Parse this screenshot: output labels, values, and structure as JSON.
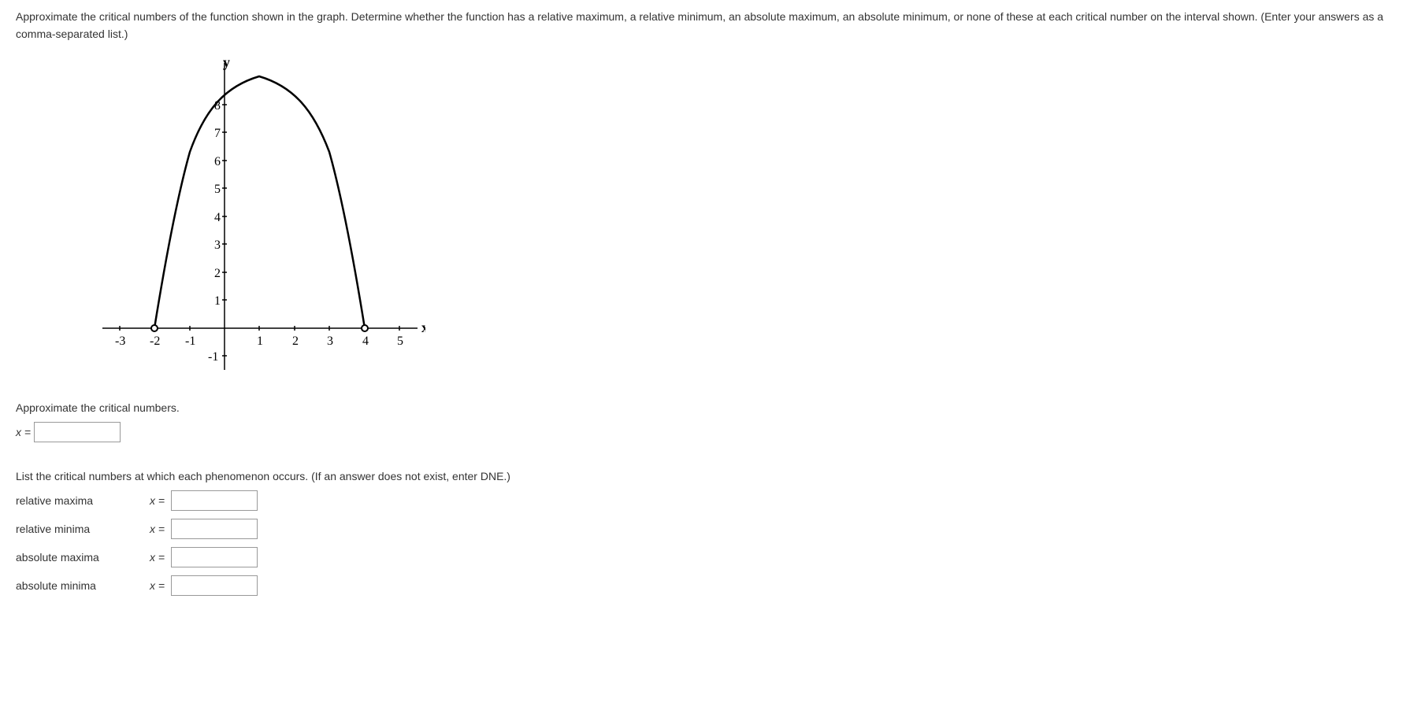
{
  "question": {
    "text": "Approximate the critical numbers of the function shown in the graph. Determine whether the function has a relative maximum, a relative minimum, an absolute maximum, an absolute minimum, or none of these at each critical number on the interval shown. (Enter your answers as a comma-separated list.)"
  },
  "chart_data": {
    "type": "line",
    "title": "",
    "xlabel": "x",
    "ylabel": "y",
    "xlim": [
      -3.5,
      5.5
    ],
    "ylim": [
      -1.5,
      9.5
    ],
    "x_ticks": [
      -3,
      -2,
      -1,
      1,
      2,
      3,
      4,
      5
    ],
    "y_ticks": [
      -1,
      1,
      2,
      3,
      4,
      5,
      6,
      7,
      8
    ],
    "x_tick_labels": [
      "-3",
      "-2",
      "-1",
      "1",
      "2",
      "3",
      "4",
      "5"
    ],
    "y_tick_labels": [
      "-1",
      "1",
      "2",
      "3",
      "4",
      "5",
      "6",
      "7",
      "8"
    ],
    "curve_description": "Downward-opening parabola-like curve",
    "endpoints": [
      {
        "x": -2,
        "y": 0,
        "open": true
      },
      {
        "x": 4,
        "y": 0,
        "open": true
      }
    ],
    "vertex": {
      "x": 1,
      "y": 9
    },
    "curve_points": [
      {
        "x": -2,
        "y": 0
      },
      {
        "x": -1.5,
        "y": 3.9
      },
      {
        "x": -1,
        "y": 6.3
      },
      {
        "x": -0.5,
        "y": 7.8
      },
      {
        "x": 0,
        "y": 8.6
      },
      {
        "x": 0.5,
        "y": 8.95
      },
      {
        "x": 1,
        "y": 9
      },
      {
        "x": 1.5,
        "y": 8.95
      },
      {
        "x": 2,
        "y": 8.6
      },
      {
        "x": 2.5,
        "y": 7.8
      },
      {
        "x": 3,
        "y": 6.3
      },
      {
        "x": 3.5,
        "y": 3.9
      },
      {
        "x": 4,
        "y": 0
      }
    ]
  },
  "prompts": {
    "approximate": "Approximate the critical numbers.",
    "list_phenomena": "List the critical numbers at which each phenomenon occurs. (If an answer does not exist, enter DNE.)"
  },
  "inputs": {
    "critical_x_label": "x =",
    "phenomena": [
      {
        "label": "relative maxima",
        "eq": "x ="
      },
      {
        "label": "relative minima",
        "eq": "x ="
      },
      {
        "label": "absolute maxima",
        "eq": "x ="
      },
      {
        "label": "absolute minima",
        "eq": "x ="
      }
    ]
  }
}
